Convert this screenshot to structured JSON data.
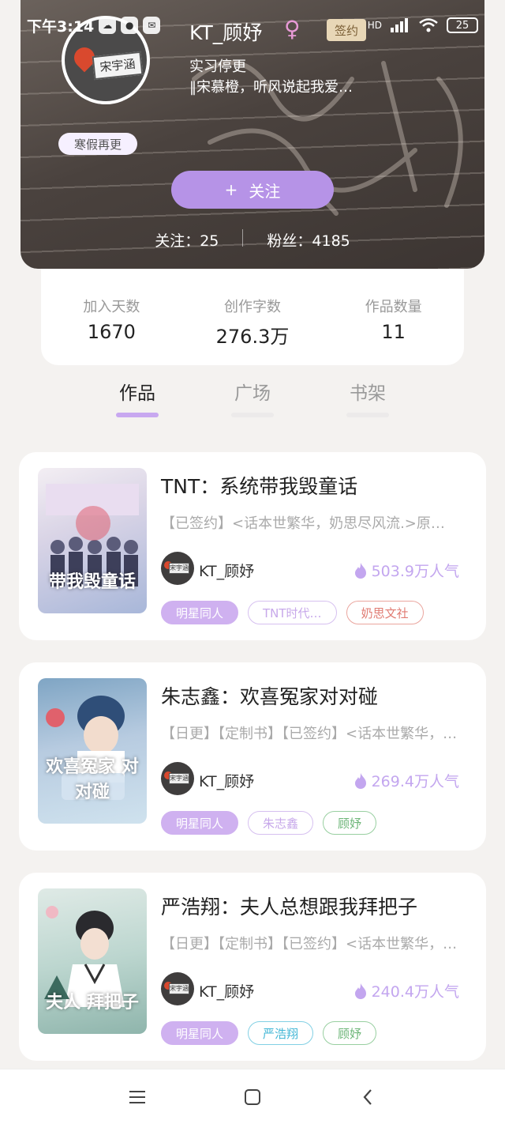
{
  "status_bar": {
    "time": "下午3:14",
    "battery": "25",
    "network": "HD"
  },
  "profile": {
    "name": "KT_顾妤",
    "gender_symbol": "♀",
    "sign_tag": "签约",
    "status": "实习停更",
    "motto": "‖宋慕橙，听风说起我爱…",
    "badge": "寒假再更",
    "avatar_text": "宋宇涵",
    "follow_button": "关注",
    "follow_icon": "+",
    "following_label": "关注：",
    "following_count": "25",
    "fans_label": "粉丝：",
    "fans_count": "4185"
  },
  "stats": [
    {
      "label": "加入天数",
      "value": "1670"
    },
    {
      "label": "创作字数",
      "value": "276.3万"
    },
    {
      "label": "作品数量",
      "value": "11"
    }
  ],
  "tabs": [
    {
      "label": "作品",
      "active": true
    },
    {
      "label": "广场",
      "active": false
    },
    {
      "label": "书架",
      "active": false
    }
  ],
  "books": [
    {
      "title": "TNT：系统带我毁童话",
      "description": "【已签约】<话本世繁华，奶思尽风流.>原…",
      "author": "KT_顾妤",
      "popularity": "503.9万人气",
      "tags": [
        {
          "label": "明星同人",
          "style": "purple"
        },
        {
          "label": "TNT时代…",
          "style": "violet"
        },
        {
          "label": "奶思文社",
          "style": "red"
        }
      ]
    },
    {
      "title": "朱志鑫：欢喜冤家对对碰",
      "description": "【日更】【定制书】【已签约】<话本世繁华，…",
      "author": "KT_顾妤",
      "popularity": "269.4万人气",
      "tags": [
        {
          "label": "明星同人",
          "style": "purple"
        },
        {
          "label": "朱志鑫",
          "style": "violet"
        },
        {
          "label": "顾妤",
          "style": "green"
        }
      ]
    },
    {
      "title": "严浩翔：夫人总想跟我拜把子",
      "description": "【日更】【定制书】【已签约】<话本世繁华，…",
      "author": "KT_顾妤",
      "popularity": "240.4万人气",
      "tags": [
        {
          "label": "明星同人",
          "style": "purple"
        },
        {
          "label": "严浩翔",
          "style": "cyan"
        },
        {
          "label": "顾妤",
          "style": "green"
        }
      ]
    }
  ],
  "covers": [
    {
      "title": "带我毁童话"
    },
    {
      "title": "欢喜冤家 对对碰"
    },
    {
      "title": "夫人 拜把子"
    }
  ],
  "colors": {
    "accent": "#b693e7",
    "tab_underline": "#c8a8f0",
    "popularity": "#c3a6ef",
    "sign_tag_bg": "#e8d7b7"
  },
  "icons": {
    "nav": [
      "menu-icon",
      "home-square-icon",
      "back-chevron-icon"
    ],
    "popularity": "flame-icon"
  }
}
